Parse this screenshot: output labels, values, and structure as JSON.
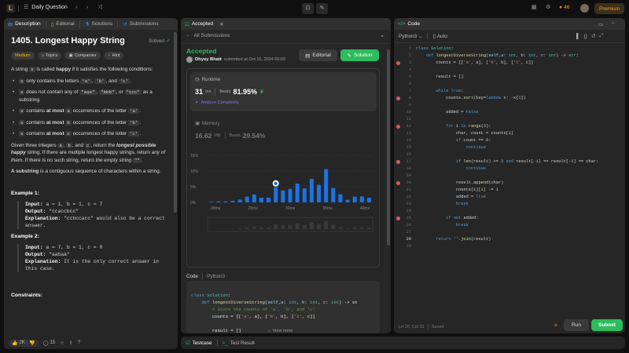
{
  "top": {
    "problem_list": "Daily Question",
    "premium": "Premium",
    "streak": "46"
  },
  "left": {
    "tabs": [
      "Description",
      "Editorial",
      "Solutions",
      "Submissions"
    ],
    "title": "1405. Longest Happy String",
    "status": "Solved",
    "tags": [
      "Medium",
      "Topics",
      "Companies",
      "Hint"
    ],
    "p1a": "A string ",
    "p1s": "s",
    "p1b": " is called ",
    "p1c": "happy",
    "p1d": " if it satisfies the following conditions:",
    "bullets": [
      {
        "pre": "",
        "c1": "s",
        "mid": " only contains the letters ",
        "c2": "'a'",
        ",": ",",
        "c3": "'b'",
        "and": ", and ",
        "c4": "'c'",
        "end": "."
      },
      {
        "pre": "",
        "c1": "s",
        "mid": " does not contain any of ",
        "c2": "\"aaa\"",
        "c3": "\"bbb\"",
        "c4": "\"ccc\"",
        "end": " as a substring."
      }
    ],
    "b3": {
      "c": "s",
      "t1": " contains ",
      "bold": "at most",
      "c2": "a",
      "t2": " occurrences of the letter ",
      "c3": "'a'",
      "end": "."
    },
    "b4": {
      "c": "s",
      "t1": " contains ",
      "bold": "at most",
      "c2": "b",
      "t2": " occurrences of the letter ",
      "c3": "'b'",
      "end": "."
    },
    "b5": {
      "c": "s",
      "t1": " contains ",
      "bold": "at most",
      "c2": "c",
      "t2": " occurrences of the letter ",
      "c3": "'c'",
      "end": "."
    },
    "given_pre": "Given three integers ",
    "g_a": "a",
    "g_b": "b",
    "g_c": "c",
    "given_mid": ", return the ",
    "given_em": "longest possible happy",
    "given_post": " string",
    "given_rest": ". If there are multiple longest happy strings, return ",
    "any_of": "any of them",
    "if_none": ". If there is no such string, return ",
    "empty": "the empty string",
    "e_code": "\"\"",
    "substr_b": "A substring",
    "substr_rest": " is a contiguous sequence of characters within a string.",
    "ex1_title": "Example 1:",
    "ex1_in": "Input:",
    "ex1_inv": " a = 1, b = 1, c = 7",
    "ex1_out": "Output:",
    "ex1_outv": " \"ccaccbcc\"",
    "ex1_exp": "Explanation:",
    "ex1_expv": " \"ccbccacc\" would also be a correct answer.",
    "ex2_title": "Example 2:",
    "ex2_in": "Input:",
    "ex2_inv": " a = 7, b = 1, c = 0",
    "ex2_out": "Output:",
    "ex2_outv": " \"aabaa\"",
    "ex2_exp": "Explanation:",
    "ex2_expv": " It is the only correct answer in this case.",
    "constraints": "Constraints:",
    "likes": "2K",
    "comments": "15"
  },
  "mid": {
    "tab": "Accepted",
    "back": "All Submissions",
    "status": "Accepted",
    "user": "Dhyey Bhatt",
    "submitted": "submitted at Oct 16, 2024 06:09",
    "editorial_btn": "Editorial",
    "solution_btn": "Solution",
    "runtime_label": "Runtime",
    "runtime_val": "31",
    "runtime_unit": "ms",
    "beats": "Beats",
    "runtime_pct": "81.95%",
    "analyze": "Analyze Complexity",
    "memory_label": "Memory",
    "memory_val": "16.62",
    "memory_unit": "MB",
    "memory_pct": "29.54%",
    "code_tab": "Code",
    "lang": "Python3",
    "view_more": "View more",
    "code_lines": [
      "class Solution:",
      "    def longestDiverseString(self,a: int, b: int, c: int) -> st",
      "        # Store the counts of 'a', 'b', and 'c'",
      "        counts = [['a', a], ['b', b], ['c', c]]",
      "",
      "        result = []",
      "",
      "        while True:"
    ]
  },
  "chart_data": {
    "type": "bar",
    "ylim": [
      0,
      15
    ],
    "y_ticks": [
      "15%",
      "10%",
      "5%",
      "0%"
    ],
    "x_ticks": [
      "20ms",
      "25ms",
      "30ms",
      "35ms",
      "40ms"
    ],
    "values": [
      0.2,
      0.3,
      0.3,
      0.5,
      0.9,
      1.8,
      2.5,
      1.5,
      1.5,
      4.8,
      3.8,
      4.3,
      6.0,
      4.5,
      7.5,
      5.6,
      10.6,
      4.6,
      2.6,
      0.8,
      1.8,
      1.9,
      1.5
    ],
    "highlight_index": 9,
    "bar_color": "#1a73e8"
  },
  "right": {
    "tab": "Code",
    "lang": "Python3",
    "auto": "Auto",
    "status": "Ln 28, Col 31",
    "saved": "Saved",
    "run": "Run",
    "submit": "Submit",
    "bottom_tabs": [
      "Testcase",
      "Test Result"
    ]
  }
}
